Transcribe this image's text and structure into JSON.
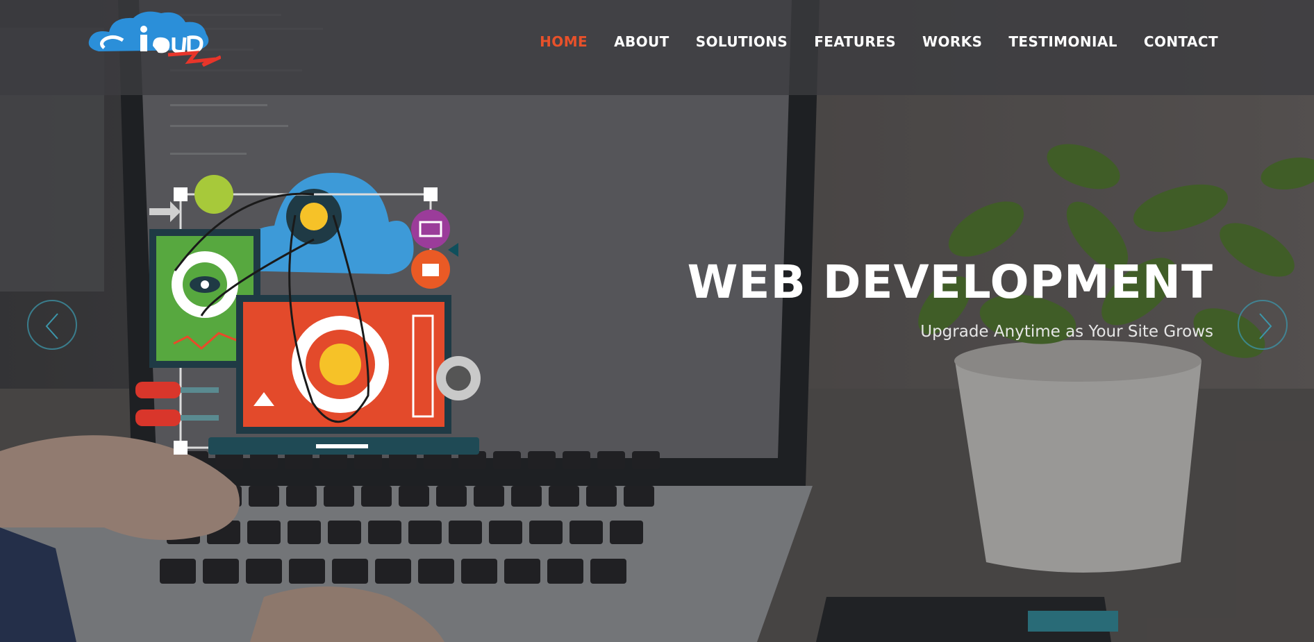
{
  "header": {
    "logo_alt": "iCloud",
    "nav": [
      {
        "label": "HOME",
        "active": true
      },
      {
        "label": "ABOUT",
        "active": false
      },
      {
        "label": "SOLUTIONS",
        "active": false
      },
      {
        "label": "FEATURES",
        "active": false
      },
      {
        "label": "WORKS",
        "active": false
      },
      {
        "label": "TESTIMONIAL",
        "active": false
      },
      {
        "label": "CONTACT",
        "active": false
      }
    ]
  },
  "slide": {
    "title": "WEB DEVELOPMENT",
    "subtitle": "Upgrade Anytime as Your Site Grows"
  },
  "colors": {
    "accent": "#e8512a",
    "nav_text": "#ffffff",
    "arrow_ring": "#3c96aa"
  },
  "icons": {
    "prev": "chevron-left-icon",
    "next": "chevron-right-icon"
  }
}
